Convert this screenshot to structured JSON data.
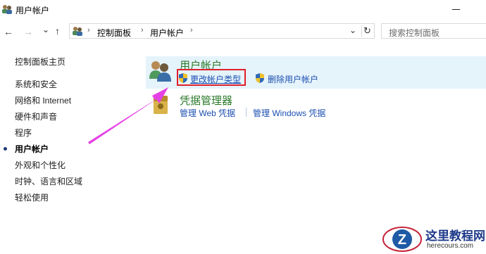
{
  "window": {
    "title": "用户帐户"
  },
  "nav": {
    "back": "←",
    "forward": "→",
    "recent": "⌄",
    "up": "↑",
    "dropdown": "⌄",
    "refresh": "↻"
  },
  "breadcrumb": [
    {
      "label": "控制面板"
    },
    {
      "label": "用户帐户"
    }
  ],
  "search": {
    "placeholder": "搜索控制面板"
  },
  "sidebar": {
    "home": "控制面板主页",
    "items": [
      {
        "label": "系统和安全"
      },
      {
        "label": "网络和 Internet"
      },
      {
        "label": "硬件和声音"
      },
      {
        "label": "程序"
      },
      {
        "label": "用户帐户",
        "current": true
      },
      {
        "label": "外观和个性化"
      },
      {
        "label": "时钟、语言和区域"
      },
      {
        "label": "轻松使用"
      }
    ]
  },
  "main": {
    "categories": [
      {
        "title": "用户帐户",
        "icon": "users-icon",
        "links": [
          {
            "label": "更改帐户类型",
            "icon": "uac-shield-icon"
          },
          {
            "label": "删除用户帐户",
            "icon": "uac-shield-icon"
          }
        ]
      },
      {
        "title": "凭据管理器",
        "icon": "credential-manager-icon",
        "links": [
          {
            "label": "管理 Web 凭据"
          },
          {
            "label": "管理 Windows 凭据"
          }
        ]
      }
    ]
  },
  "annotation": {
    "color": "#e542e5",
    "highlight_color": "#e01f2b"
  },
  "watermark": {
    "site_name": "这里教程网",
    "url": "herecours.com"
  }
}
